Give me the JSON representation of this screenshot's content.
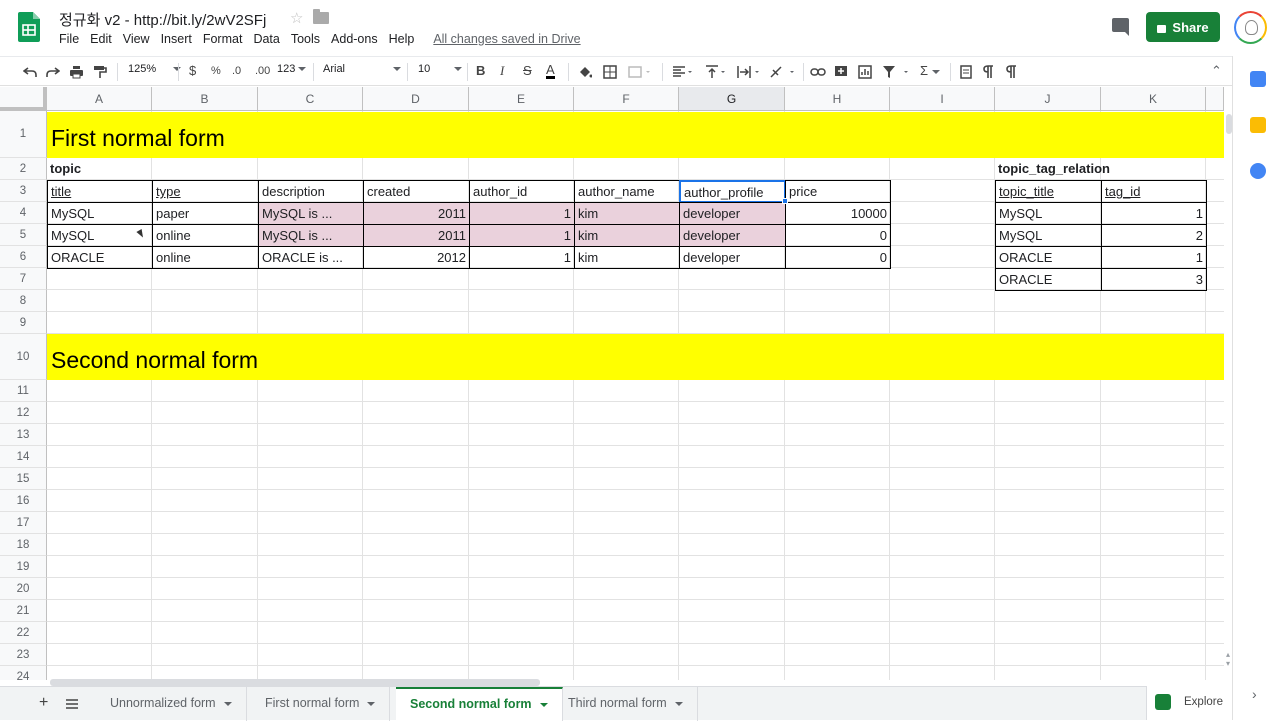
{
  "app": {
    "title": "정규화 v2  -  http://bit.ly/2wV2SFj",
    "menu": [
      "File",
      "Edit",
      "View",
      "Insert",
      "Format",
      "Data",
      "Tools",
      "Add-ons",
      "Help"
    ],
    "save_status": "All changes saved in Drive",
    "share_label": "Share"
  },
  "toolbar": {
    "zoom": "125%",
    "currency": "$",
    "percent": "%",
    "decimal_decrease": ".0",
    "decimal_increase": ".00",
    "more_formats": "123",
    "font": "Arial",
    "font_size": "10",
    "bold": "B",
    "italic": "I",
    "strike": "S",
    "text_color": "A",
    "sigma": "Σ"
  },
  "columns": [
    "A",
    "B",
    "C",
    "D",
    "E",
    "F",
    "G",
    "H",
    "I",
    "J",
    "K"
  ],
  "rows": [
    "1",
    "2",
    "3",
    "4",
    "5",
    "6",
    "7",
    "8",
    "9",
    "10",
    "11",
    "12",
    "13",
    "14",
    "15",
    "16",
    "17",
    "18",
    "19",
    "20",
    "21",
    "22",
    "23",
    "24"
  ],
  "sheet": {
    "band1": "First normal form",
    "band2": "Second normal form",
    "topic_label": "topic",
    "topic_headers": [
      "title",
      "type",
      "description",
      "created",
      "author_id",
      "author_name",
      "author_profile",
      "price"
    ],
    "topic_rows": [
      [
        "MySQL",
        "paper",
        "MySQL is ...",
        "2011",
        "1",
        "kim",
        "developer",
        "10000"
      ],
      [
        "MySQL",
        "online",
        "MySQL is ...",
        "2011",
        "1",
        "kim",
        "developer",
        "0"
      ],
      [
        "ORACLE",
        "online",
        "ORACLE is ...",
        "2012",
        "1",
        "kim",
        "developer",
        "0"
      ]
    ],
    "relation_label": "topic_tag_relation",
    "relation_headers": [
      "topic_title",
      "tag_id"
    ],
    "relation_rows": [
      [
        "MySQL",
        "1"
      ],
      [
        "MySQL",
        "2"
      ],
      [
        "ORACLE",
        "1"
      ],
      [
        "ORACLE",
        "3"
      ]
    ]
  },
  "tabs": [
    "Unnormalized form",
    "First normal form",
    "Second normal form",
    "Third normal form"
  ],
  "active_tab": "Second normal form",
  "explore_label": "Explore",
  "colors": {
    "band": "#ffff00",
    "highlight": "#ead1dc",
    "accent": "#188038",
    "selection": "#1a73e8"
  }
}
